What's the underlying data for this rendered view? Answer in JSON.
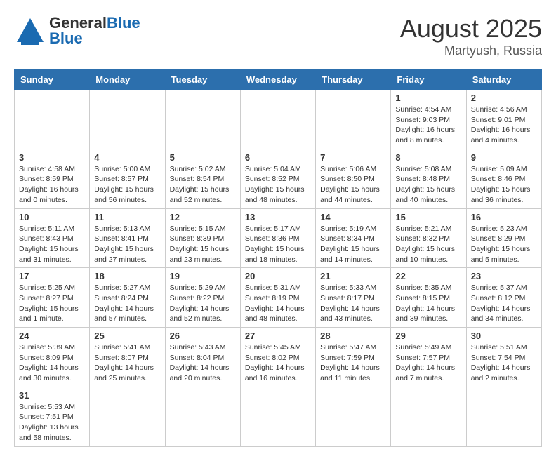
{
  "logo": {
    "text_general": "General",
    "text_blue": "Blue"
  },
  "title": "August 2025",
  "subtitle": "Martyush, Russia",
  "weekdays": [
    "Sunday",
    "Monday",
    "Tuesday",
    "Wednesday",
    "Thursday",
    "Friday",
    "Saturday"
  ],
  "weeks": [
    [
      {
        "day": "",
        "info": ""
      },
      {
        "day": "",
        "info": ""
      },
      {
        "day": "",
        "info": ""
      },
      {
        "day": "",
        "info": ""
      },
      {
        "day": "",
        "info": ""
      },
      {
        "day": "1",
        "info": "Sunrise: 4:54 AM\nSunset: 9:03 PM\nDaylight: 16 hours and 8 minutes."
      },
      {
        "day": "2",
        "info": "Sunrise: 4:56 AM\nSunset: 9:01 PM\nDaylight: 16 hours and 4 minutes."
      }
    ],
    [
      {
        "day": "3",
        "info": "Sunrise: 4:58 AM\nSunset: 8:59 PM\nDaylight: 16 hours and 0 minutes."
      },
      {
        "day": "4",
        "info": "Sunrise: 5:00 AM\nSunset: 8:57 PM\nDaylight: 15 hours and 56 minutes."
      },
      {
        "day": "5",
        "info": "Sunrise: 5:02 AM\nSunset: 8:54 PM\nDaylight: 15 hours and 52 minutes."
      },
      {
        "day": "6",
        "info": "Sunrise: 5:04 AM\nSunset: 8:52 PM\nDaylight: 15 hours and 48 minutes."
      },
      {
        "day": "7",
        "info": "Sunrise: 5:06 AM\nSunset: 8:50 PM\nDaylight: 15 hours and 44 minutes."
      },
      {
        "day": "8",
        "info": "Sunrise: 5:08 AM\nSunset: 8:48 PM\nDaylight: 15 hours and 40 minutes."
      },
      {
        "day": "9",
        "info": "Sunrise: 5:09 AM\nSunset: 8:46 PM\nDaylight: 15 hours and 36 minutes."
      }
    ],
    [
      {
        "day": "10",
        "info": "Sunrise: 5:11 AM\nSunset: 8:43 PM\nDaylight: 15 hours and 31 minutes."
      },
      {
        "day": "11",
        "info": "Sunrise: 5:13 AM\nSunset: 8:41 PM\nDaylight: 15 hours and 27 minutes."
      },
      {
        "day": "12",
        "info": "Sunrise: 5:15 AM\nSunset: 8:39 PM\nDaylight: 15 hours and 23 minutes."
      },
      {
        "day": "13",
        "info": "Sunrise: 5:17 AM\nSunset: 8:36 PM\nDaylight: 15 hours and 18 minutes."
      },
      {
        "day": "14",
        "info": "Sunrise: 5:19 AM\nSunset: 8:34 PM\nDaylight: 15 hours and 14 minutes."
      },
      {
        "day": "15",
        "info": "Sunrise: 5:21 AM\nSunset: 8:32 PM\nDaylight: 15 hours and 10 minutes."
      },
      {
        "day": "16",
        "info": "Sunrise: 5:23 AM\nSunset: 8:29 PM\nDaylight: 15 hours and 5 minutes."
      }
    ],
    [
      {
        "day": "17",
        "info": "Sunrise: 5:25 AM\nSunset: 8:27 PM\nDaylight: 15 hours and 1 minute."
      },
      {
        "day": "18",
        "info": "Sunrise: 5:27 AM\nSunset: 8:24 PM\nDaylight: 14 hours and 57 minutes."
      },
      {
        "day": "19",
        "info": "Sunrise: 5:29 AM\nSunset: 8:22 PM\nDaylight: 14 hours and 52 minutes."
      },
      {
        "day": "20",
        "info": "Sunrise: 5:31 AM\nSunset: 8:19 PM\nDaylight: 14 hours and 48 minutes."
      },
      {
        "day": "21",
        "info": "Sunrise: 5:33 AM\nSunset: 8:17 PM\nDaylight: 14 hours and 43 minutes."
      },
      {
        "day": "22",
        "info": "Sunrise: 5:35 AM\nSunset: 8:15 PM\nDaylight: 14 hours and 39 minutes."
      },
      {
        "day": "23",
        "info": "Sunrise: 5:37 AM\nSunset: 8:12 PM\nDaylight: 14 hours and 34 minutes."
      }
    ],
    [
      {
        "day": "24",
        "info": "Sunrise: 5:39 AM\nSunset: 8:09 PM\nDaylight: 14 hours and 30 minutes."
      },
      {
        "day": "25",
        "info": "Sunrise: 5:41 AM\nSunset: 8:07 PM\nDaylight: 14 hours and 25 minutes."
      },
      {
        "day": "26",
        "info": "Sunrise: 5:43 AM\nSunset: 8:04 PM\nDaylight: 14 hours and 20 minutes."
      },
      {
        "day": "27",
        "info": "Sunrise: 5:45 AM\nSunset: 8:02 PM\nDaylight: 14 hours and 16 minutes."
      },
      {
        "day": "28",
        "info": "Sunrise: 5:47 AM\nSunset: 7:59 PM\nDaylight: 14 hours and 11 minutes."
      },
      {
        "day": "29",
        "info": "Sunrise: 5:49 AM\nSunset: 7:57 PM\nDaylight: 14 hours and 7 minutes."
      },
      {
        "day": "30",
        "info": "Sunrise: 5:51 AM\nSunset: 7:54 PM\nDaylight: 14 hours and 2 minutes."
      }
    ],
    [
      {
        "day": "31",
        "info": "Sunrise: 5:53 AM\nSunset: 7:51 PM\nDaylight: 13 hours and 58 minutes."
      },
      {
        "day": "",
        "info": ""
      },
      {
        "day": "",
        "info": ""
      },
      {
        "day": "",
        "info": ""
      },
      {
        "day": "",
        "info": ""
      },
      {
        "day": "",
        "info": ""
      },
      {
        "day": "",
        "info": ""
      }
    ]
  ]
}
